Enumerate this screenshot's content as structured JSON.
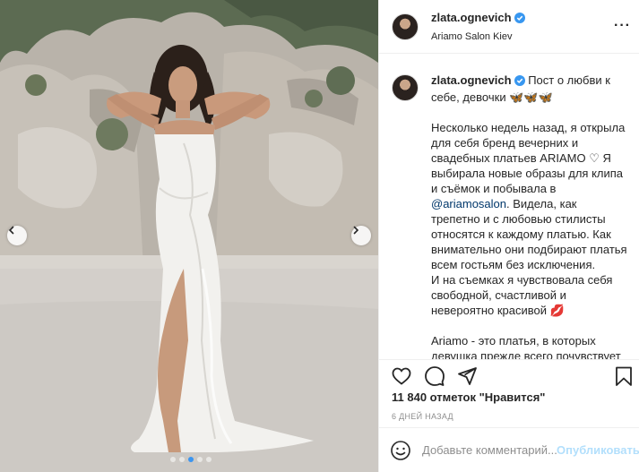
{
  "post": {
    "author": {
      "username": "zlata.ognevich",
      "verified": true,
      "location": "Ariamo Salon Kiev"
    },
    "caption": {
      "username": "zlata.ognevich",
      "line_1": " Пост о любви к себе, девочки ",
      "line_1_emoji": "🦋🦋🦋",
      "para_1_a": "Несколько недель назад, я открыла для себя бренд вечерних и свадебных платьев ARIAMO ",
      "para_1_heart": "♡",
      "para_1_b": " Я выбирала новые образы для клипа и съёмок и побывала в ",
      "mention": "@ariamosalon",
      "para_1_c": ". Видела, как трепетно и с любовью стилисты относятся к каждому платью. Как внимательно они подбирают платья всем гостьям без исключения.",
      "para_2": "И на съемках я чувствовала себя свободной, счастливой и невероятно красивой ",
      "para_2_emoji": "💋",
      "para_3": "Ariamo - это платья, в которых девушка прежде всего почувствует себя СОБОЙ."
    },
    "likes_text": "11 840 отметок \"Нравится\"",
    "time_text": "6 ДНЕЙ НАЗАД",
    "add_comment": {
      "placeholder": "Добавьте комментарий...",
      "publish_label": "Опубликовать"
    },
    "carousel": {
      "total_slides": 5,
      "active_slide": 3
    }
  },
  "icons": {
    "like": "heart-icon",
    "comment": "comment-icon",
    "share": "share-icon",
    "save": "bookmark-icon",
    "more": "more-options-icon",
    "verified": "verified-badge-icon",
    "nav_prev": "chevron-left-icon",
    "nav_next": "chevron-right-icon"
  },
  "colors": {
    "verified": "#3897f0",
    "link": "#00376b",
    "muted": "#8e8e8e",
    "publish_disabled": "#b2dffc",
    "carousel_active": "#3b95f0"
  }
}
